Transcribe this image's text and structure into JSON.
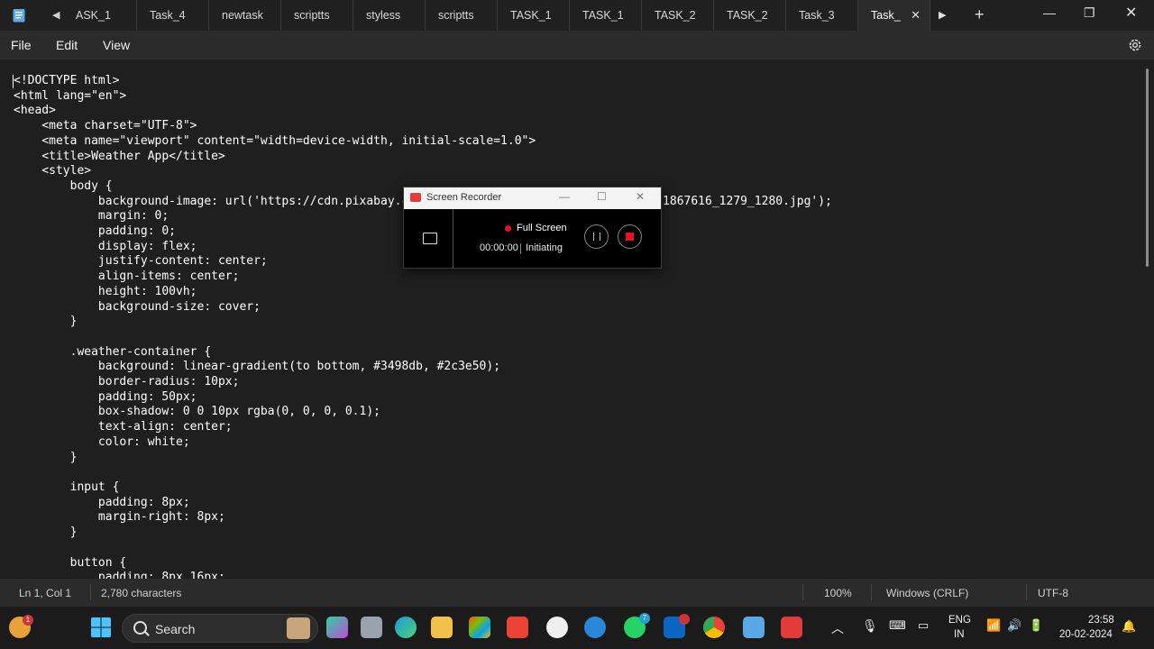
{
  "tabs": [
    {
      "label": "ASK_1",
      "width": 82
    },
    {
      "label": "Task_4",
      "width": 80
    },
    {
      "label": "newtask",
      "width": 80
    },
    {
      "label": "scriptts",
      "width": 80
    },
    {
      "label": "styless",
      "width": 80
    },
    {
      "label": "scriptts",
      "width": 80
    },
    {
      "label": "TASK_1",
      "width": 80
    },
    {
      "label": "TASK_1",
      "width": 80
    },
    {
      "label": "TASK_2",
      "width": 80
    },
    {
      "label": "TASK_2",
      "width": 80
    },
    {
      "label": "Task_3",
      "width": 80
    }
  ],
  "active_tab": {
    "label": "Task_"
  },
  "menu": {
    "file": "File",
    "edit": "Edit",
    "view": "View"
  },
  "code": "<!DOCTYPE html>\n<html lang=\"en\">\n<head>\n    <meta charset=\"UTF-8\">\n    <meta name=\"viewport\" content=\"width=device-width, initial-scale=1.0\">\n    <title>Weather App</title>\n    <style>\n        body {\n            background-image: url('https://cdn.pixabay.com/photo/2016/11/29/05/45/astronomy-1867616_1279_1280.jpg');\n            margin: 0;\n            padding: 0;\n            display: flex;\n            justify-content: center;\n            align-items: center;\n            height: 100vh;\n            background-size: cover;\n        }\n\n        .weather-container {\n            background: linear-gradient(to bottom, #3498db, #2c3e50);\n            border-radius: 10px;\n            padding: 50px;\n            box-shadow: 0 0 10px rgba(0, 0, 0, 0.1);\n            text-align: center;\n            color: white;\n        }\n\n        input {\n            padding: 8px;\n            margin-right: 8px;\n        }\n\n        button {\n            padding: 8px 16px;",
  "status": {
    "position": "Ln 1, Col 1",
    "characters": "2,780 characters",
    "zoom": "100%",
    "line_ending": "Windows (CRLF)",
    "encoding": "UTF-8"
  },
  "recorder": {
    "title": "Screen Recorder",
    "mode": "Full Screen",
    "time": "00:00:00",
    "status": "Initiating"
  },
  "taskbar": {
    "search": "Search",
    "lang_top": "ENG",
    "lang_bottom": "IN",
    "time": "23:58",
    "date": "20-02-2024",
    "weather_badge": "1",
    "whatsapp_badge": "7"
  }
}
